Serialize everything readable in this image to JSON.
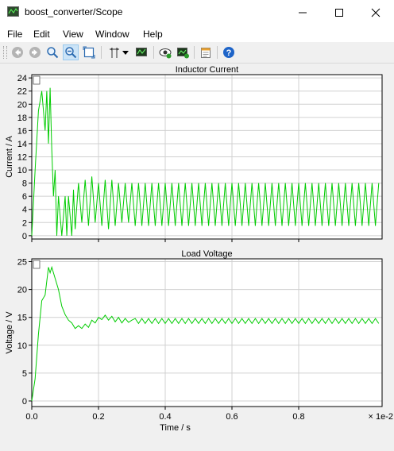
{
  "window": {
    "title": "boost_converter/Scope",
    "controls": [
      "minimize",
      "maximize",
      "close"
    ]
  },
  "menu": {
    "items": [
      {
        "label": "File"
      },
      {
        "label": "Edit"
      },
      {
        "label": "View"
      },
      {
        "label": "Window"
      },
      {
        "label": "Help"
      }
    ]
  },
  "toolbar": {
    "buttons": [
      {
        "icon": "back-icon"
      },
      {
        "icon": "forward-icon"
      },
      {
        "icon": "zoom-in-icon"
      },
      {
        "icon": "zoom-out-icon",
        "active": true
      },
      {
        "icon": "zoom-fit-icon"
      },
      {
        "icon": "cursor-icon"
      },
      {
        "icon": "dropdown-arrow-icon"
      },
      {
        "icon": "signal-display-icon"
      },
      {
        "icon": "visibility-icon"
      },
      {
        "icon": "add-plot-icon"
      },
      {
        "icon": "properties-icon"
      },
      {
        "icon": "help-icon"
      }
    ]
  },
  "colors": {
    "trace": "#00cc00",
    "plot_background": "#ffffff",
    "grid": "#d0d0d0",
    "frame": "#000000",
    "help_blue": "#1e64c8"
  },
  "chart_data": [
    {
      "type": "line",
      "title": "Inductor Current",
      "xlabel": "",
      "ylabel": "Current / A",
      "xlim": [
        0,
        1.05
      ],
      "ylim": [
        -0.5,
        24.5
      ],
      "xticks": [
        "0.0",
        "0.2",
        "0.4",
        "0.6",
        "0.8"
      ],
      "yticks": [
        "0",
        "2",
        "4",
        "6",
        "8",
        "10",
        "12",
        "14",
        "16",
        "18",
        "20",
        "22",
        "24"
      ],
      "grid": true,
      "x_multiplier": "",
      "series": [
        {
          "x": [
            0,
            0.01,
            0.02,
            0.03,
            0.04,
            0.045,
            0.05,
            0.055,
            0.06,
            0.065,
            0.07,
            0.075,
            0.08,
            0.09,
            0.1,
            0.105,
            0.11,
            0.12,
            0.125,
            0.13,
            0.14,
            0.15,
            0.16,
            0.17,
            0.18,
            0.19,
            0.2,
            0.21,
            0.22,
            0.23,
            0.24,
            0.25,
            0.26,
            0.27,
            0.28,
            0.29,
            0.3
          ],
          "y": [
            0,
            10,
            19,
            22,
            16,
            22,
            14,
            22.5,
            13,
            6,
            10,
            0,
            6,
            0,
            6,
            0,
            6,
            0,
            7,
            1,
            8,
            2,
            8.5,
            1.5,
            9,
            2,
            8,
            1.5,
            8.5,
            1,
            8.5,
            1.5,
            8,
            2,
            8,
            2,
            8
          ]
        }
      ]
    },
    {
      "type": "line",
      "title": "Load Voltage",
      "xlabel": "Time / s",
      "ylabel": "Voltage / V",
      "xlim": [
        0,
        1.05
      ],
      "ylim": [
        -1,
        25.5
      ],
      "xticks": [
        "0.0",
        "0.2",
        "0.4",
        "0.6",
        "0.8"
      ],
      "yticks": [
        "0",
        "5",
        "10",
        "15",
        "20",
        "25"
      ],
      "grid": true,
      "x_multiplier": "× 1e-2",
      "series": [
        {
          "x": [
            0,
            0.01,
            0.02,
            0.03,
            0.04,
            0.05,
            0.055,
            0.06,
            0.07,
            0.08,
            0.09,
            0.1,
            0.11,
            0.12,
            0.13,
            0.14,
            0.15,
            0.16,
            0.17,
            0.18,
            0.19,
            0.2,
            0.21,
            0.22,
            0.23,
            0.24,
            0.25,
            0.26,
            0.27,
            0.28,
            0.29,
            0.3
          ],
          "y": [
            0,
            4,
            12,
            18,
            19,
            24,
            23,
            24,
            22,
            20,
            17,
            15.5,
            14.5,
            14,
            13,
            13.5,
            13,
            13.8,
            13.2,
            14.5,
            14,
            15,
            14.6,
            15.4,
            14.5,
            15.2,
            14.2,
            15,
            14,
            14.8,
            14.1,
            14.5
          ]
        }
      ]
    }
  ]
}
